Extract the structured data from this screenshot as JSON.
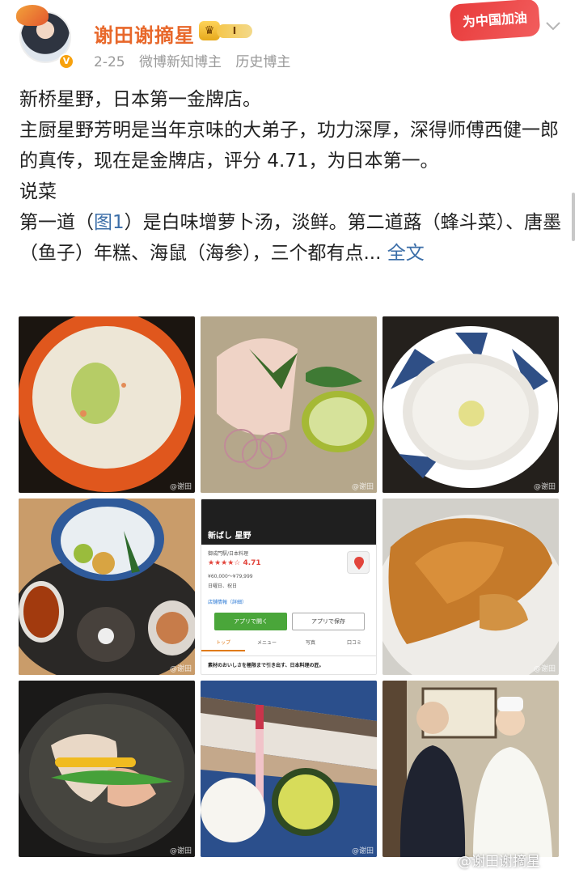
{
  "header": {
    "username": "谢田谢摘星",
    "vip_level": "I",
    "date": "2-25",
    "tag1": "微博新知博主",
    "tag2": "历史博主",
    "badge_text": "为中国加油",
    "verified_mark": "V"
  },
  "post": {
    "line1": "新桥星野，日本第一金牌店。",
    "line2": "主厨星野芳明是当年京味的大弟子，功力深厚，深得师傅西健一郎的真传，现在是金牌店，评分 4.71，为日本第一。",
    "line3": "说菜",
    "line4_a": "第一道（",
    "line4_link": "图1",
    "line4_b": "）是白味增萝卜汤，淡鲜。第二道蕗（蜂斗菜）、唐墨（鱼子）年糕、海鼠（海参），三个都有点...",
    "more_link": "全文"
  },
  "app_shot": {
    "name": "新ばし 星野",
    "category": "御成門駅/日本料理",
    "rating": "★★★★☆ 4.71",
    "price": "¥60,000～¥79,999",
    "hours": "日曜日、祝日",
    "info": "店舗情報（詳細）",
    "open_btn": "アプリで開く",
    "save_btn": "アプリで保存",
    "tabs": [
      "トップ",
      "メニュー",
      "写真",
      "口コミ"
    ],
    "desc": "素材のおいしさを極限まで引き出す、日本料理の匠。"
  },
  "watermarks": {
    "cell": "@谢田",
    "footer": "@谢田谢摘星"
  },
  "colors": {
    "username": "#e8682b",
    "link": "#3b6ea8",
    "badge": "#e83b3b"
  }
}
